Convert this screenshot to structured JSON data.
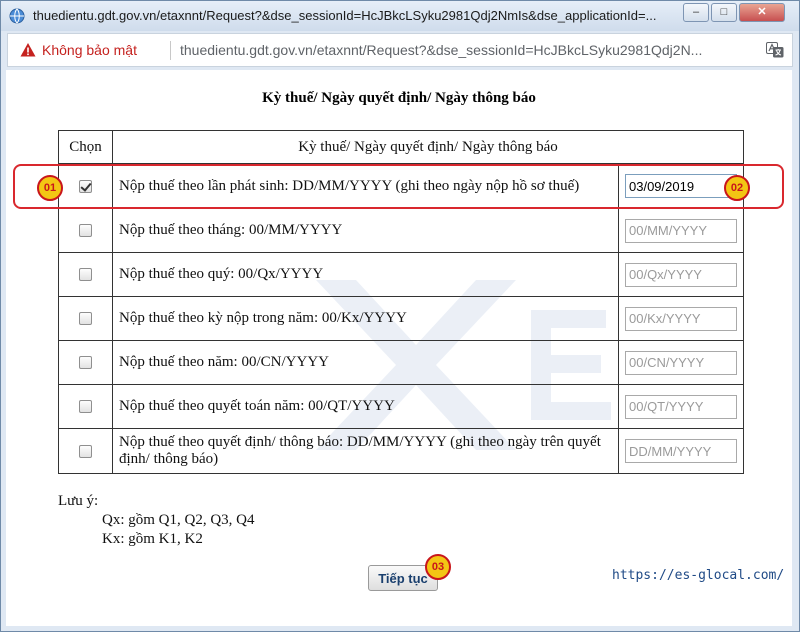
{
  "window": {
    "title": "thuedientu.gdt.gov.vn/etaxnnt/Request?&dse_sessionId=HcJBkcLSyku2981Qdj2NmIs&dse_applicationId=...",
    "min_glyph": "–",
    "max_glyph": "□",
    "close_glyph": "✕"
  },
  "addressbar": {
    "security_label": "Không bảo mật",
    "url": "thuedientu.gdt.gov.vn/etaxnnt/Request?&dse_sessionId=HcJBkcLSyku2981Qdj2N..."
  },
  "page": {
    "heading": "Kỳ thuế/ Ngày quyết định/ Ngày thông báo",
    "table": {
      "col_select": "Chọn",
      "col_period": "Kỳ thuế/ Ngày quyết định/ Ngày thông báo",
      "rows": [
        {
          "label": "Nộp thuế theo lần phát sinh: DD/MM/YYYY (ghi theo ngày nộp hồ sơ thuế)",
          "value": "03/09/2019",
          "placeholder": "",
          "checked": true
        },
        {
          "label": "Nộp thuế theo tháng: 00/MM/YYYY",
          "value": "",
          "placeholder": "00/MM/YYYY",
          "checked": false
        },
        {
          "label": "Nộp thuế theo quý: 00/Qx/YYYY",
          "value": "",
          "placeholder": "00/Qx/YYYY",
          "checked": false
        },
        {
          "label": "Nộp thuế theo kỳ nộp trong năm: 00/Kx/YYYY",
          "value": "",
          "placeholder": "00/Kx/YYYY",
          "checked": false
        },
        {
          "label": "Nộp thuế theo năm: 00/CN/YYYY",
          "value": "",
          "placeholder": "00/CN/YYYY",
          "checked": false
        },
        {
          "label": "Nộp thuế theo quyết toán năm: 00/QT/YYYY",
          "value": "",
          "placeholder": "00/QT/YYYY",
          "checked": false
        },
        {
          "label": "Nộp thuế theo quyết định/ thông báo: DD/MM/YYYY (ghi theo ngày trên quyết định/ thông báo)",
          "value": "",
          "placeholder": "DD/MM/YYYY",
          "checked": false
        }
      ]
    },
    "note": {
      "title": "Lưu ý:",
      "line1": "Qx: gồm Q1, Q2, Q3, Q4",
      "line2": "Kx: gồm K1, K2"
    },
    "continue_label": "Tiếp tục",
    "site_link": "https://es-glocal.com/"
  },
  "annotations": {
    "badge1": "01",
    "badge2": "02",
    "badge3": "03",
    "color": "#d9282e",
    "badge_fill": "#f3c614"
  }
}
